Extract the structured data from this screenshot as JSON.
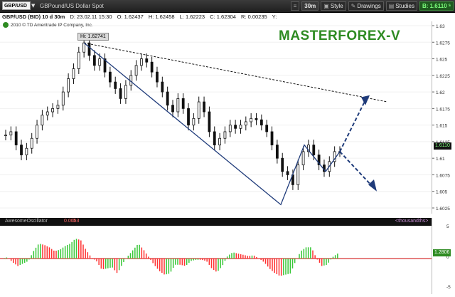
{
  "toolbar": {
    "symbol": "GBP/USD",
    "description": "GBPound/US Dollar Spot",
    "period": "30m",
    "style_label": "Style",
    "drawings_label": "Drawings",
    "studies_label": "Studies",
    "bid_label": "B: 1.6110",
    "bid_suffix": "s"
  },
  "info": {
    "pair": "GBP/USD (BID) 10 d 30m",
    "date": "D: 23.02.11 15:30",
    "open": "O: 1.62437",
    "high": "H: 1.62458",
    "low": "L: 1.62223",
    "close": "C: 1.62304",
    "range": "R: 0.00235",
    "y": "Y:"
  },
  "chart": {
    "copyright": "2010 © TD Ameritrade IP Company, Inc.",
    "watermark": "MASTERFOREX-V",
    "hi_label": "Hi: 1.62741",
    "price_tag": "1.6110"
  },
  "oscillator": {
    "name": "AwesomeOscillator",
    "value1": "0.0053",
    "value2": "0",
    "unit": "<thousandths>",
    "current": "1.2806",
    "ticks": [
      "5",
      "0",
      "-5"
    ]
  },
  "colors": {
    "bg": "#ffffff",
    "candle": "#111111",
    "trendline": "#1f3b7a",
    "dashed": "#1f3b7a",
    "resistance": "#111111",
    "watermark": "#2e8b22",
    "osc_up": "#38c738",
    "osc_down": "#ff3030"
  },
  "chart_data": {
    "type": "line",
    "title": "",
    "xlabel": "",
    "ylabel": "",
    "ylim": [
      1.6025,
      1.63
    ],
    "y_ticks": [
      "1.63",
      "1.6275",
      "1.625",
      "1.6225",
      "1.62",
      "1.6175",
      "1.615",
      "1.6125",
      "1.61",
      "1.6075",
      "1.605",
      "1.6025"
    ],
    "series": [
      {
        "values": [
          1.6135,
          1.614,
          1.612,
          1.6105,
          1.6115,
          1.613,
          1.615,
          1.6165,
          1.617,
          1.6175,
          1.618,
          1.62,
          1.622,
          1.6235,
          1.626,
          1.6274,
          1.6255,
          1.624,
          1.625,
          1.623,
          1.6215,
          1.6205,
          1.619,
          1.621,
          1.6225,
          1.624,
          1.625,
          1.6245,
          1.623,
          1.6215,
          1.62,
          1.618,
          1.617,
          1.619,
          1.6175,
          1.615,
          1.616,
          1.6185,
          1.617,
          1.614,
          1.612,
          1.613,
          1.614,
          1.615,
          1.6145,
          1.615,
          1.6155,
          1.616,
          1.6158,
          1.615,
          1.614,
          1.612,
          1.61,
          1.608,
          1.6075,
          1.606,
          1.609,
          1.611,
          1.612,
          1.6105,
          1.609,
          1.608,
          1.6095,
          1.611,
          1.611
        ]
      }
    ]
  }
}
